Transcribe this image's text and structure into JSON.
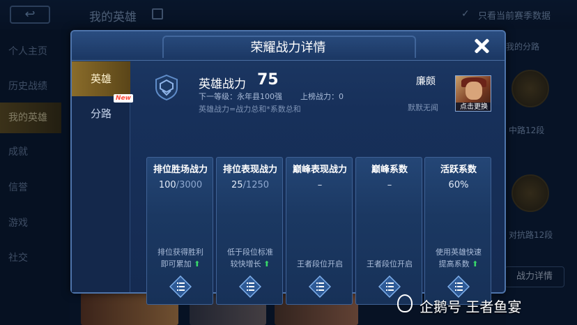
{
  "background": {
    "back_symbol": "↩",
    "title": "我的英雄",
    "filter_label": "只看当前赛季数据",
    "nav": [
      "个人主页",
      "历史战绩",
      "我的英雄",
      "成就",
      "信誉",
      "游戏",
      "社交"
    ],
    "right_label": "我的分路",
    "right_sub_1": "中路12段",
    "right_sub_2": "对抗路12段",
    "detail_button": "战力详情"
  },
  "modal": {
    "title": "荣耀战力详情",
    "close_icon": "close-icon",
    "tabs": [
      {
        "label": "英雄",
        "active": true
      },
      {
        "label": "分路",
        "badge": "New"
      }
    ],
    "hero_power": {
      "title": "英雄战力",
      "value": "75",
      "next_level": "下一等级：永年县100强",
      "rank_power": "上榜战力：0",
      "formula": "英雄战力=战力总和*系数总和"
    },
    "hero": {
      "name": "廉颇",
      "default_area": "默默无闻",
      "change_label": "点击更换"
    },
    "cards": [
      {
        "title": "排位胜场战力",
        "current": "100",
        "total": "3000",
        "desc_1": "排位获得胜利",
        "desc_2": "即可累加",
        "arrow": "⬆"
      },
      {
        "title": "排位表现战力",
        "current": "25",
        "total": "1250",
        "desc_1": "低于段位标准",
        "desc_2": "较快增长",
        "arrow": "⬆"
      },
      {
        "title": "巅峰表现战力",
        "current": "–",
        "total": "",
        "desc_1": "王者段位开启",
        "desc_2": "",
        "arrow": ""
      },
      {
        "title": "巅峰系数",
        "current": "–",
        "total": "",
        "desc_1": "王者段位开启",
        "desc_2": "",
        "arrow": ""
      },
      {
        "title": "活跃系数",
        "current": "60%",
        "total": "",
        "desc_1": "使用英雄快速",
        "desc_2": "提高系数",
        "arrow": "⬆"
      }
    ]
  },
  "watermark": {
    "text": "企鹅号 王者鱼宴"
  },
  "colors": {
    "accent_gold": "#8a6c2a",
    "panel_blue": "#1b3862",
    "up_green": "#38d86a"
  }
}
